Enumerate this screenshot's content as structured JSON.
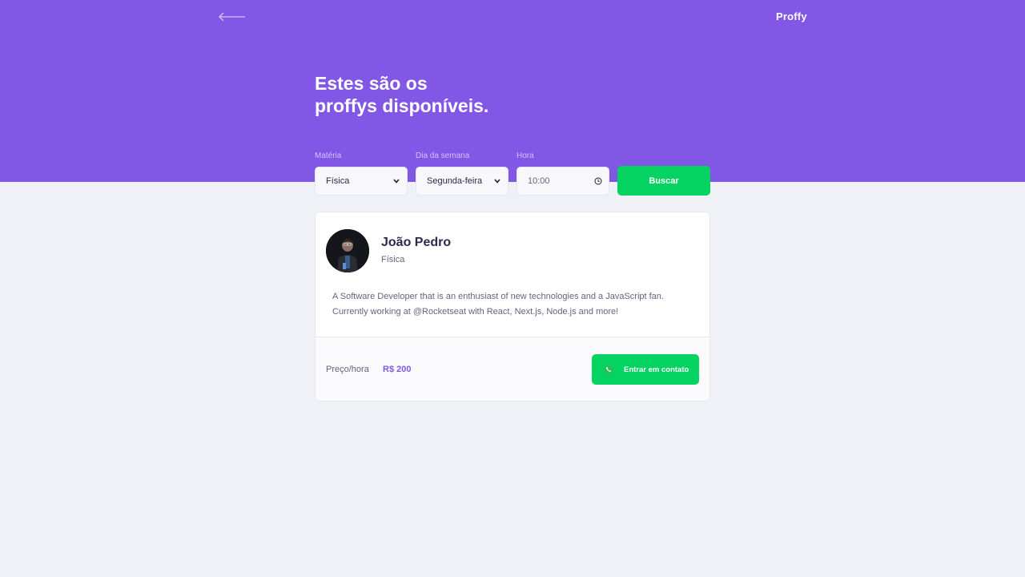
{
  "header": {
    "logo": "Proffy",
    "title_line1": "Estes são os",
    "title_line2": "proffys disponíveis."
  },
  "filters": {
    "subject": {
      "label": "Matéria",
      "value": "Física"
    },
    "weekday": {
      "label": "Dia da semana",
      "value": "Segunda-feira"
    },
    "time": {
      "label": "Hora",
      "value": "10:00"
    },
    "search_label": "Buscar"
  },
  "teacher": {
    "name": "João Pedro",
    "subject": "Física",
    "bio": "A Software Developer that is an enthusiast of new technologies and a JavaScript fan. Currently working at @Rocketseat with React, Next.js, Node.js and more!",
    "price_label": "Preço/hora",
    "price_value": "R$ 200",
    "contact_label": "Entrar em contato"
  },
  "icons": {
    "back": "arrow-left-icon",
    "chevron": "chevron-down-icon",
    "clock": "clock-icon",
    "whatsapp": "whatsapp-icon"
  },
  "colors": {
    "primary": "#8257e5",
    "secondary": "#04d361",
    "background": "#f0f0f7",
    "title_text": "#32264d",
    "body_text": "#6a6180"
  }
}
